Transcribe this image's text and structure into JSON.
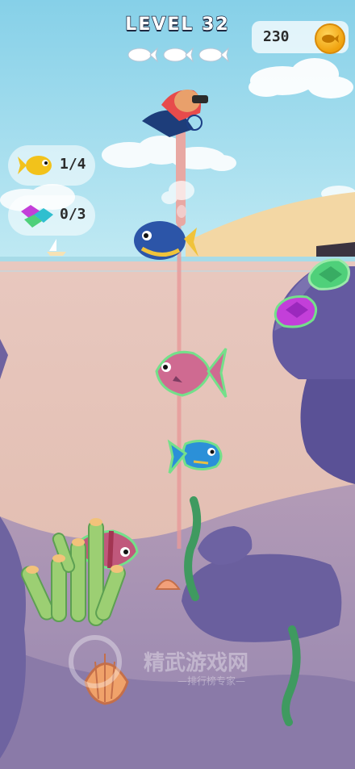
{
  "hud": {
    "level_label": "LEVEL 32",
    "coins": "230",
    "coin_icon": "fish-coin-icon",
    "lives_total": 3,
    "lives_remaining": 3
  },
  "goals": [
    {
      "icon": "yellow-fish-icon",
      "progress": "1/4"
    },
    {
      "icon": "gem-icon",
      "progress": "0/3"
    }
  ],
  "colors": {
    "sky": "#8fd3ea",
    "water": "#e7c3b9",
    "sand": "#f5d9a6",
    "rock": "#6b5f9f",
    "coin": "#f2a91c"
  }
}
